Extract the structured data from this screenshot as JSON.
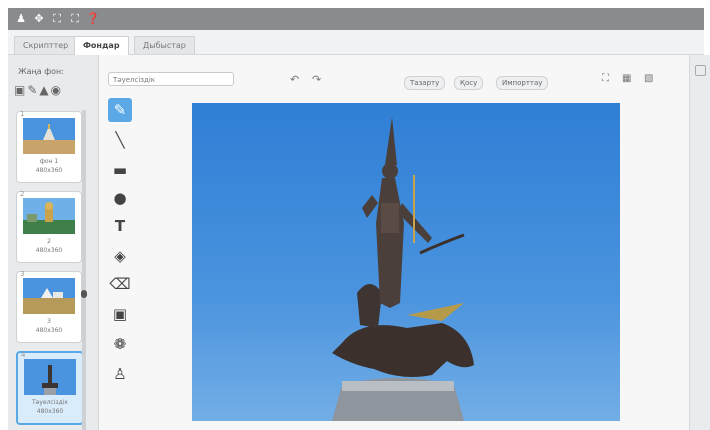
{
  "tabs": [
    {
      "label": "Скрипттер",
      "active": false
    },
    {
      "label": "Фондар",
      "active": true
    },
    {
      "label": "Дыбыстар",
      "active": false
    }
  ],
  "sidebar": {
    "title": "Жаңа фон:",
    "backdrops": [
      {
        "index": "1",
        "name": "фон 1",
        "size": "480x360",
        "selected": false
      },
      {
        "index": "2",
        "name": "2",
        "size": "480x360",
        "selected": false
      },
      {
        "index": "3",
        "name": "3",
        "size": "480x360",
        "selected": false
      },
      {
        "index": "4",
        "name": "Тәуелсіздік",
        "size": "480x360",
        "selected": true
      }
    ]
  },
  "editor": {
    "costume_name": "Тәуелсіздік",
    "buttons": {
      "clear": "Тазарту",
      "add": "Қосу",
      "import": "Импорттау"
    }
  },
  "icons": {
    "topbar": [
      "person-icon",
      "move-icon",
      "grow-icon",
      "shrink-icon",
      "help-icon"
    ],
    "tools": [
      "brush-icon",
      "line-icon",
      "rectangle-icon",
      "ellipse-icon",
      "text-icon",
      "fill-icon",
      "eraser-icon",
      "select-icon",
      "stamp-icon",
      "duplicate-icon"
    ]
  },
  "colors": {
    "accent": "#5aa9e6",
    "sky": "#3f89db",
    "topbar": "#8a8b8e"
  }
}
